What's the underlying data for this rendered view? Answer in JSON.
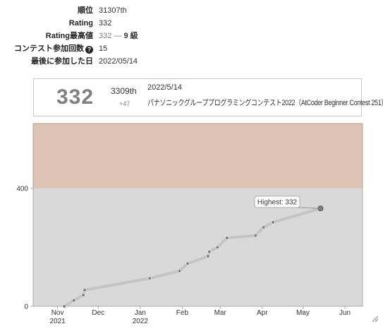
{
  "profile": {
    "rank_label": "順位",
    "rank_value": "31307th",
    "rating_label": "Rating",
    "rating_value": "332",
    "highest_label": "Rating最高値",
    "highest_value": "332",
    "highest_dash": "—",
    "highest_kyu": "9 級",
    "contests_label": "コンテスト参加回数",
    "contests_info_icon": "question-circle-icon",
    "contests_value": "15",
    "last_label": "最後に参加した日",
    "last_value": "2022/05/14"
  },
  "status_card": {
    "rating": "332",
    "rank": "3309th",
    "diff": "+47",
    "date": "2022/5/14",
    "contest": "パナソニックグループプログラミングコンテスト2022（AtCoder Beginner Contest 251）"
  },
  "colors": {
    "gray_band": "#d9d9d9",
    "brown_band": "#dcc3b3",
    "line": "#bdbdbd",
    "point": "#808080",
    "rating_gray": "#808080"
  },
  "chart_data": {
    "type": "line",
    "y_ticks": [
      "0",
      "400"
    ],
    "ylim": [
      0,
      620
    ],
    "x_ticks": [
      {
        "date": "2021-11-01",
        "label": "Nov",
        "sub": "2021"
      },
      {
        "date": "2021-12-01",
        "label": "Dec",
        "sub": ""
      },
      {
        "date": "2022-01-01",
        "label": "Jan",
        "sub": "2022"
      },
      {
        "date": "2022-02-01",
        "label": "Feb",
        "sub": ""
      },
      {
        "date": "2022-03-01",
        "label": "Mar",
        "sub": ""
      },
      {
        "date": "2022-04-01",
        "label": "Apr",
        "sub": ""
      },
      {
        "date": "2022-05-01",
        "label": "May",
        "sub": ""
      },
      {
        "date": "2022-06-01",
        "label": "Jun",
        "sub": ""
      }
    ],
    "xlim": [
      "2021-10-14",
      "2022-06-14"
    ],
    "bands": [
      {
        "from": 0,
        "to": 400,
        "color": "#d9d9d9"
      },
      {
        "from": 400,
        "to": 620,
        "color": "#dcc3b3"
      }
    ],
    "series": [
      {
        "points": [
          {
            "date": "2021-11-06",
            "value": 0
          },
          {
            "date": "2021-11-13",
            "value": 20
          },
          {
            "date": "2021-11-20",
            "value": 38
          },
          {
            "date": "2021-11-21",
            "value": 55
          },
          {
            "date": "2022-01-08",
            "value": 95
          },
          {
            "date": "2022-01-30",
            "value": 120
          },
          {
            "date": "2022-02-05",
            "value": 145
          },
          {
            "date": "2022-02-20",
            "value": 170
          },
          {
            "date": "2022-02-21",
            "value": 185
          },
          {
            "date": "2022-02-27",
            "value": 200
          },
          {
            "date": "2022-03-06",
            "value": 232
          },
          {
            "date": "2022-03-27",
            "value": 240
          },
          {
            "date": "2022-04-02",
            "value": 268
          },
          {
            "date": "2022-04-09",
            "value": 285
          },
          {
            "date": "2022-05-14",
            "value": 332
          }
        ]
      }
    ],
    "annotation": "Highest: 332"
  },
  "chart_controls": {
    "resize_icon": "resize-corner-icon"
  }
}
